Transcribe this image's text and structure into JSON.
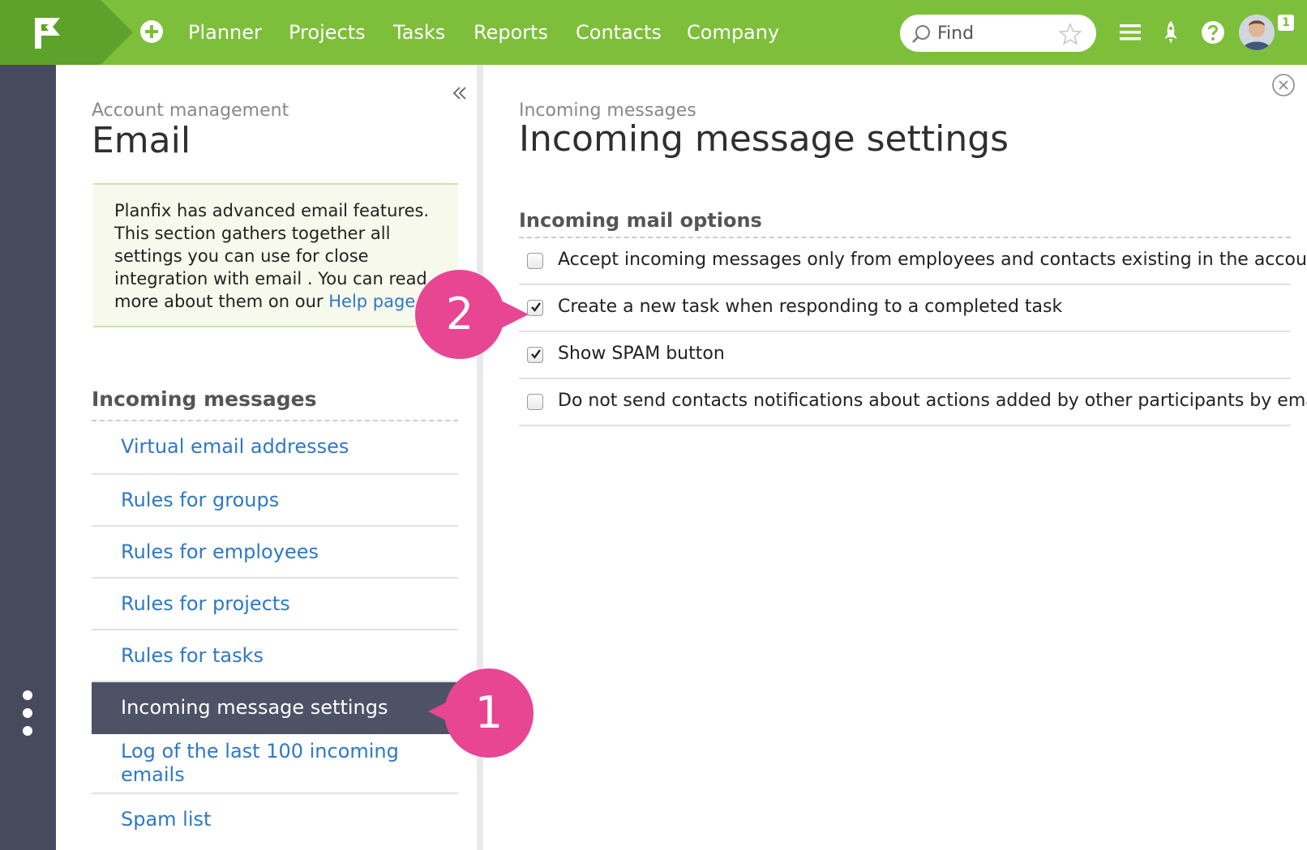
{
  "topbar": {
    "nav": [
      "Planner",
      "Projects",
      "Tasks",
      "Reports",
      "Contacts",
      "Company"
    ],
    "search_placeholder": "Find",
    "notification_count": "1",
    "icons": [
      "flag-logo-icon",
      "plus-circle-icon",
      "search-icon",
      "star-icon",
      "menu-icon",
      "rocket-icon",
      "help-icon",
      "avatar"
    ],
    "colors": {
      "bar": "#7dbf3b",
      "logo_block": "#5da22a"
    }
  },
  "left_panel": {
    "subtitle": "Account management",
    "title": "Email",
    "info": {
      "text": "Planfix has advanced email features. This section gathers together all settings you can use for close integration with email . You can read more about them on our ",
      "link": "Help page",
      "end": "."
    },
    "section_heading": "Incoming messages",
    "menu": [
      {
        "label": "Virtual email addresses",
        "active": false
      },
      {
        "label": "Rules for groups",
        "active": false
      },
      {
        "label": "Rules for employees",
        "active": false
      },
      {
        "label": "Rules for projects",
        "active": false
      },
      {
        "label": "Rules for tasks",
        "active": false
      },
      {
        "label": "Incoming message settings",
        "active": true
      },
      {
        "label": "Log of the last 100 incoming emails",
        "active": false
      },
      {
        "label": "Spam list",
        "active": false
      }
    ]
  },
  "right_panel": {
    "subtitle": "Incoming messages",
    "title": "Incoming message settings",
    "options_heading": "Incoming mail options",
    "options": [
      {
        "label": "Accept incoming messages only from employees and contacts existing in the account",
        "checked": false
      },
      {
        "label": "Create a new task when responding to a completed task",
        "checked": true
      },
      {
        "label": "Show SPAM button",
        "checked": true
      },
      {
        "label": "Do not send contacts notifications about actions added by other participants by email",
        "checked": false
      }
    ]
  },
  "callouts": [
    "1",
    "2"
  ],
  "colors": {
    "sidebar": "#464a5c",
    "active_item": "#4e5266",
    "link": "#2f78c4",
    "callout": "#e84593"
  }
}
